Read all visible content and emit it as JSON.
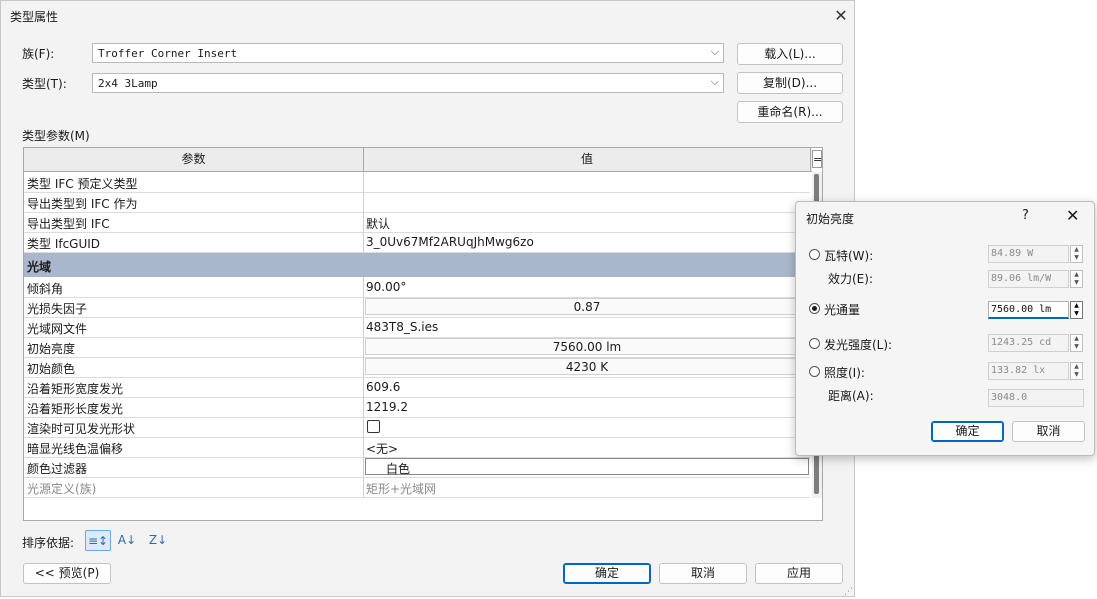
{
  "dialog": {
    "title": "类型属性",
    "family_label": "族(F):",
    "family_value": "Troffer Corner Insert",
    "type_label": "类型(T):",
    "type_value": "2x4 3Lamp",
    "load_button": "载入(L)...",
    "duplicate_button": "复制(D)...",
    "rename_button": "重命名(R)...",
    "type_params_label": "类型参数(M)",
    "sort_label": "排序依据:",
    "preview_button": "<< 预览(P)",
    "ok_button": "确定",
    "cancel_button": "取消",
    "apply_button": "应用"
  },
  "table": {
    "col_param": "参数",
    "col_value": "值",
    "col_toggle": "=",
    "rows_top": [
      {
        "param": "类型 IFC 预定义类型",
        "value": ""
      },
      {
        "param": "导出类型到 IFC 作为",
        "value": ""
      },
      {
        "param": "导出类型到 IFC",
        "value": "默认"
      },
      {
        "param": "类型 IfcGUID",
        "value": "3_0Uv67Mf2ARUqJhMwg6zo"
      }
    ],
    "group_name": "光域",
    "rows_group": [
      {
        "param": "倾斜角",
        "value": "90.00°"
      },
      {
        "param": "光损失因子",
        "value": "0.87"
      },
      {
        "param": "光域网文件",
        "value": "483T8_S.ies"
      },
      {
        "param": "初始亮度",
        "value": "7560.00 lm"
      },
      {
        "param": "初始颜色",
        "value": "4230 K"
      },
      {
        "param": "沿着矩形宽度发光",
        "value": "609.6"
      },
      {
        "param": "沿着矩形长度发光",
        "value": "1219.2"
      },
      {
        "param": "渲染时可见发光形状",
        "value": ""
      },
      {
        "param": "暗显光线色温偏移",
        "value": "<无>"
      },
      {
        "param": "颜色过滤器",
        "value": "白色"
      },
      {
        "param": "光源定义(族)",
        "value": "矩形+光域网"
      }
    ]
  },
  "sub": {
    "title": "初始亮度",
    "help": "?",
    "watt_label": "瓦特(W):",
    "watt_value": "84.89 W",
    "efficacy_label": "效力(E):",
    "efficacy_value": "89.06 lm/W",
    "flux_label": "光通量",
    "flux_value": "7560.00 lm",
    "intensity_label": "发光强度(L):",
    "intensity_value": "1243.25 cd",
    "illuminance_label": "照度(I):",
    "illuminance_value": "133.82 lx",
    "distance_label": "距离(A):",
    "distance_value": "3048.0",
    "ok_button": "确定",
    "cancel_button": "取消"
  },
  "icons": {
    "close": "close-icon",
    "chevron": "chevron-down-icon",
    "sort_group": "sort-by-group-icon",
    "sort_az": "sort-ascending-icon",
    "sort_za": "sort-descending-icon",
    "resize": "resize-grip-icon"
  }
}
